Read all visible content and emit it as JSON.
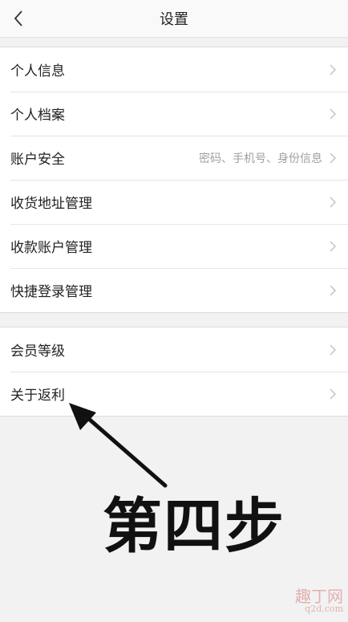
{
  "header": {
    "title": "设置"
  },
  "group1": [
    {
      "label": "个人信息"
    },
    {
      "label": "个人档案"
    },
    {
      "label": "账户安全",
      "hint": "密码、手机号、身份信息"
    },
    {
      "label": "收货地址管理"
    },
    {
      "label": "收款账户管理"
    },
    {
      "label": "快捷登录管理"
    }
  ],
  "group2": [
    {
      "label": "会员等级"
    },
    {
      "label": "关于返利"
    }
  ],
  "annotation": {
    "text": "第四步"
  },
  "watermark": {
    "line1": "趣丁网",
    "line2": "q2d.com"
  }
}
